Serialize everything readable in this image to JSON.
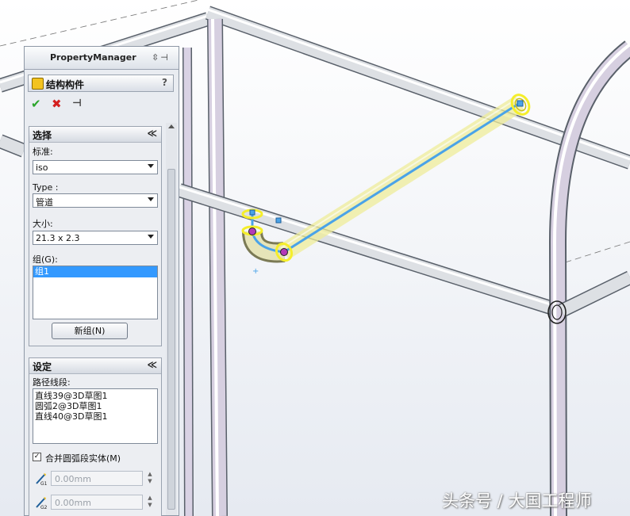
{
  "property_manager": {
    "title": "PropertyManager",
    "feature_title": "结构构件",
    "help_glyph": "?",
    "ok_glyph": "✔",
    "cancel_glyph": "✖",
    "pin_glyph": "⊣",
    "selection": {
      "header": "选择",
      "collapse_glyph": "≪",
      "standard_label": "标准:",
      "standard_value": "iso",
      "type_label": "Type :",
      "type_value": "管道",
      "size_label": "大小:",
      "size_value": "21.3 x 2.3",
      "groups_label": "组(G):",
      "groups": [
        "组1"
      ],
      "new_group_button": "新组(N)"
    },
    "settings": {
      "header": "设定",
      "collapse_glyph": "≪",
      "path_segments_label": "路径线段:",
      "path_segments": [
        "直线39@3D草图1",
        "圆弧2@3D草图1",
        "直线40@3D草图1"
      ],
      "merge_arc_label": "合并圆弧段实体(M)",
      "merge_arc_checked": true,
      "gap1_value": "0.00mm",
      "gap2_value": "0.00mm"
    }
  },
  "watermark": "头条号 / 大国工程师",
  "colors": {
    "accent": "#3399ff",
    "highlight": "#f5ee2a",
    "path_line": "#4aa3e8",
    "pipe_gray": "#cfd3d8"
  }
}
